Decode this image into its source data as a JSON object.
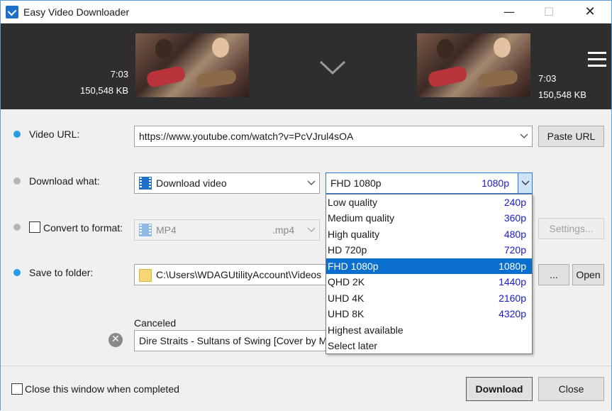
{
  "window": {
    "title": "Easy Video Downloader"
  },
  "titlebar": {
    "minimize": "—",
    "maximize": "☐",
    "close": "✕"
  },
  "header": {
    "left": {
      "duration": "7:03",
      "size": "150,548 KB"
    },
    "right": {
      "duration": "7:03",
      "size": "150,548 KB"
    }
  },
  "rows": {
    "video_url": {
      "label": "Video URL:",
      "value": "https://www.youtube.com/watch?v=PcVJrul4sOA",
      "button": "Paste URL"
    },
    "download_what": {
      "label": "Download what:",
      "value": "Download video"
    },
    "quality": {
      "selected_name": "FHD 1080p",
      "selected_value": "1080p"
    },
    "convert": {
      "label": "Convert to format:",
      "format": "MP4",
      "ext": ".mp4",
      "button": "Settings..."
    },
    "save": {
      "label": "Save to folder:",
      "path": "C:\\Users\\WDAGUtilityAccount\\Videos",
      "browse_button": "...",
      "open_button": "Open"
    }
  },
  "quality_options": [
    {
      "name": "Low quality",
      "value": "240p"
    },
    {
      "name": "Medium quality",
      "value": "360p"
    },
    {
      "name": "High quality",
      "value": "480p"
    },
    {
      "name": "HD 720p",
      "value": "720p"
    },
    {
      "name": "FHD 1080p",
      "value": "1080p"
    },
    {
      "name": "QHD 2K",
      "value": "1440p"
    },
    {
      "name": "UHD 4K",
      "value": "2160p"
    },
    {
      "name": "UHD 8K",
      "value": "4320p"
    },
    {
      "name": "Highest available",
      "value": ""
    },
    {
      "name": "Select later",
      "value": ""
    }
  ],
  "status": {
    "label": "Canceled",
    "file": "Dire Straits - Sultans of Swing [Cover by Ma"
  },
  "footer": {
    "close_when_completed": "Close this window when completed",
    "download_button": "Download",
    "close_button": "Close"
  },
  "colors": {
    "accent": "#2a9be8",
    "selection": "#0b6fd0",
    "header_bg": "#2e2e2e"
  }
}
